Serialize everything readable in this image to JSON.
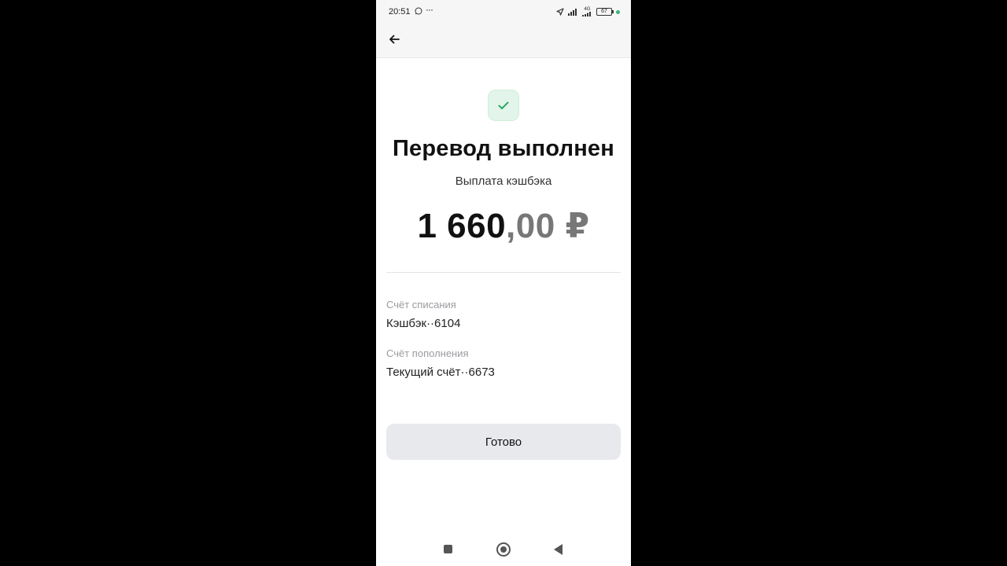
{
  "status_bar": {
    "time": "20:51",
    "more": "···",
    "network": "4G",
    "battery": "67"
  },
  "header": {
    "back_icon": "arrow-left-icon"
  },
  "result": {
    "icon": "checkmark-icon",
    "title": "Перевод выполнен",
    "subtitle": "Выплата кэшбэка",
    "amount_int": "1 660",
    "amount_frac": ",00 ₽"
  },
  "details": {
    "from_label": "Счёт списания",
    "from_value": "Кэшбэк··6104",
    "to_label": "Счёт пополнения",
    "to_value": "Текущий счёт··6673"
  },
  "actions": {
    "done_label": "Готово"
  },
  "colors": {
    "success_bg": "#e3f5ea",
    "success_check": "#2fa866",
    "button_bg": "#e8e9ec",
    "status_dot": "#3bb37a"
  }
}
